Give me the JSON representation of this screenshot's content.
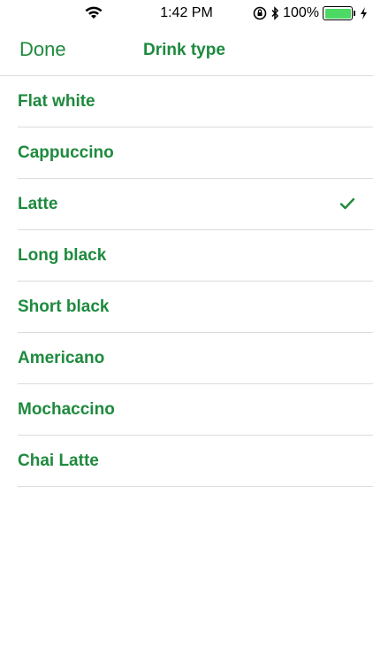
{
  "status_bar": {
    "time": "1:42 PM",
    "battery_percent": "100%",
    "icons": [
      "wifi-icon",
      "orientation-lock-icon",
      "bluetooth-icon",
      "battery-icon",
      "charging-icon"
    ]
  },
  "nav": {
    "done_label": "Done",
    "title": "Drink type"
  },
  "colors": {
    "accent": "#1e8a3e",
    "separator": "#dcdcdc",
    "battery": "#4cd964"
  },
  "drinks": [
    {
      "label": "Flat white",
      "selected": false
    },
    {
      "label": "Cappuccino",
      "selected": false
    },
    {
      "label": "Latte",
      "selected": true
    },
    {
      "label": "Long black",
      "selected": false
    },
    {
      "label": "Short black",
      "selected": false
    },
    {
      "label": "Americano",
      "selected": false
    },
    {
      "label": "Mochaccino",
      "selected": false
    },
    {
      "label": "Chai Latte",
      "selected": false
    }
  ]
}
